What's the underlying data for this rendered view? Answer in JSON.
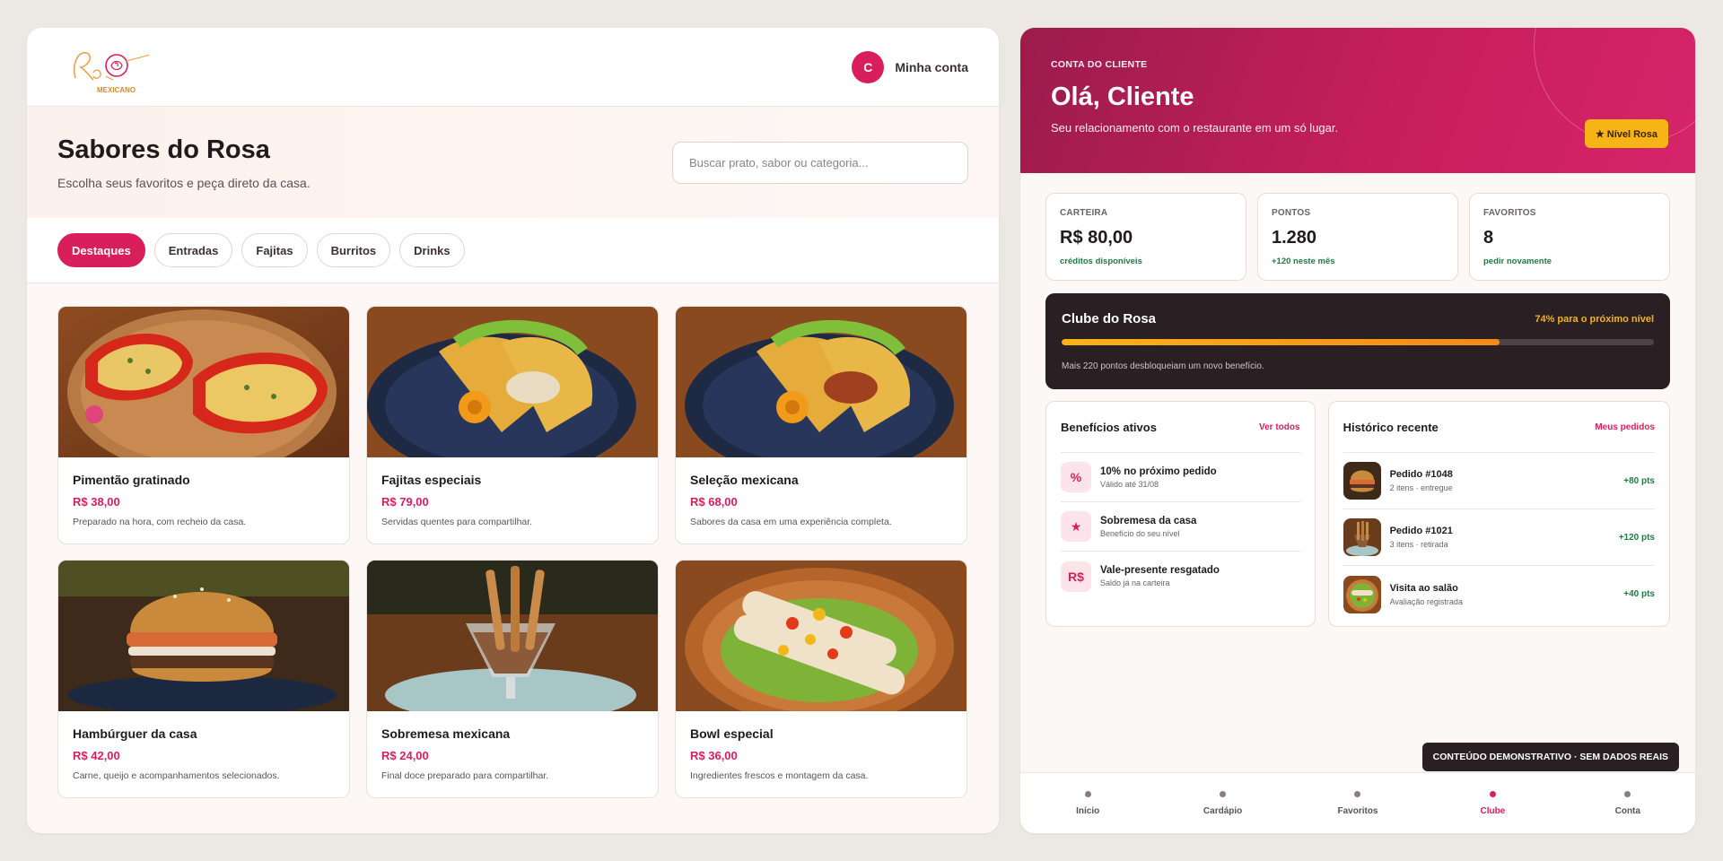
{
  "brand": {
    "logo_text": "Rosa",
    "logo_sub": "MEXICANO",
    "primary": "#d81e5b",
    "accent": "#f7b416"
  },
  "header": {
    "avatar_initial": "C",
    "account_label": "Minha conta"
  },
  "hero": {
    "title": "Sabores do Rosa",
    "subtitle": "Escolha seus favoritos e peça direto da casa.",
    "search_placeholder": "Buscar prato, sabor ou categoria..."
  },
  "tabs": [
    {
      "label": "Destaques",
      "active": true
    },
    {
      "label": "Entradas"
    },
    {
      "label": "Fajitas"
    },
    {
      "label": "Burritos"
    },
    {
      "label": "Drinks"
    }
  ],
  "menu": [
    {
      "name": "Pimentão gratinado",
      "price": "R$ 38,00",
      "desc": "Preparado na hora, com recheio da casa."
    },
    {
      "name": "Fajitas especiais",
      "price": "R$ 79,00",
      "desc": "Servidas quentes para compartilhar."
    },
    {
      "name": "Seleção mexicana",
      "price": "R$ 68,00",
      "desc": "Sabores da casa em uma experiência completa."
    },
    {
      "name": "Hambúrguer da casa",
      "price": "R$ 42,00",
      "desc": "Carne, queijo e acompanhamentos selecionados."
    },
    {
      "name": "Sobremesa mexicana",
      "price": "R$ 24,00",
      "desc": "Final doce preparado para compartilhar."
    },
    {
      "name": "Bowl especial",
      "price": "R$ 36,00",
      "desc": "Ingredientes frescos e montagem da casa."
    }
  ],
  "account": {
    "kicker": "CONTA DO CLIENTE",
    "greeting": "Olá, Cliente",
    "tagline": "Seu relacionamento com o restaurante em um só lugar.",
    "level_button": "★ Nível Rosa"
  },
  "stats": [
    {
      "label": "CARTEIRA",
      "value": "R$ 80,00",
      "sub": "créditos disponíveis"
    },
    {
      "label": "PONTOS",
      "value": "1.280",
      "sub": "+120 neste mês"
    },
    {
      "label": "FAVORITOS",
      "value": "8",
      "sub": "pedir novamente"
    }
  ],
  "club": {
    "title": "Clube do Rosa",
    "progress_label": "74% para o próximo nível",
    "progress": 0.74,
    "note": "Mais 220 pontos desbloqueiam um novo benefício."
  },
  "benefits": {
    "title": "Benefícios ativos",
    "link": "Ver todos",
    "items": [
      {
        "icon": "%",
        "title": "10% no próximo pedido",
        "sub": "Válido até 31/08"
      },
      {
        "icon": "★",
        "title": "Sobremesa da casa",
        "sub": "Benefício do seu nível"
      },
      {
        "icon": "R$",
        "title": "Vale-presente resgatado",
        "sub": "Saldo já na carteira"
      }
    ]
  },
  "history": {
    "title": "Histórico recente",
    "link": "Meus pedidos",
    "items": [
      {
        "title": "Pedido #1048",
        "sub": "2 itens · entregue",
        "pts": "+80 pts"
      },
      {
        "title": "Pedido #1021",
        "sub": "3 itens · retirada",
        "pts": "+120 pts"
      },
      {
        "title": "Visita ao salão",
        "sub": "Avaliação registrada",
        "pts": "+40 pts"
      }
    ]
  },
  "demo_badge": "CONTEÚDO DEMONSTRATIVO · SEM DADOS REAIS",
  "nav": [
    {
      "label": "Início"
    },
    {
      "label": "Cardápio"
    },
    {
      "label": "Favoritos"
    },
    {
      "label": "Clube",
      "active": true
    },
    {
      "label": "Conta"
    }
  ]
}
